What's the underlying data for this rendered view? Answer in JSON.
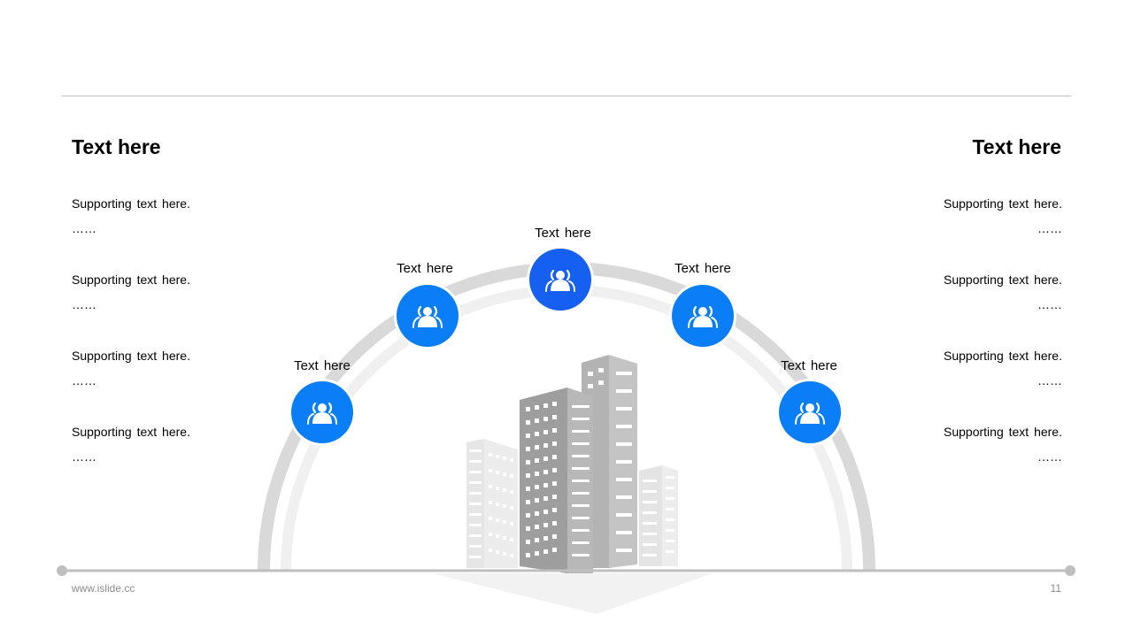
{
  "left_panel": {
    "title": "Text here",
    "items": [
      {
        "text": "Supporting text here.",
        "ellipsis": "……"
      },
      {
        "text": "Supporting text here.",
        "ellipsis": "……"
      },
      {
        "text": "Supporting text here.",
        "ellipsis": "……"
      },
      {
        "text": "Supporting text here.",
        "ellipsis": "……"
      }
    ]
  },
  "right_panel": {
    "title": "Text here",
    "items": [
      {
        "text": "Supporting text here.",
        "ellipsis": "……"
      },
      {
        "text": "Supporting text here.",
        "ellipsis": "……"
      },
      {
        "text": "Supporting text here.",
        "ellipsis": "……"
      },
      {
        "text": "Supporting text here.",
        "ellipsis": "……"
      }
    ]
  },
  "arc_nodes": [
    {
      "label": "Text here",
      "icon": "user-group-icon",
      "color": "#0a7ef7"
    },
    {
      "label": "Text here",
      "icon": "user-group-icon",
      "color": "#0a7ef7"
    },
    {
      "label": "Text here",
      "icon": "user-group-icon",
      "color": "#1560f0"
    },
    {
      "label": "Text here",
      "icon": "user-group-icon",
      "color": "#0a7ef7"
    },
    {
      "label": "Text here",
      "icon": "user-group-icon",
      "color": "#0a7ef7"
    }
  ],
  "colors": {
    "accent": "#0a7ef7",
    "accent_dark": "#1560f0",
    "arc": "#d9d9d9",
    "arc_inner": "#f0f0f0"
  },
  "footer": {
    "url": "www.islide.cc",
    "page": "11"
  }
}
